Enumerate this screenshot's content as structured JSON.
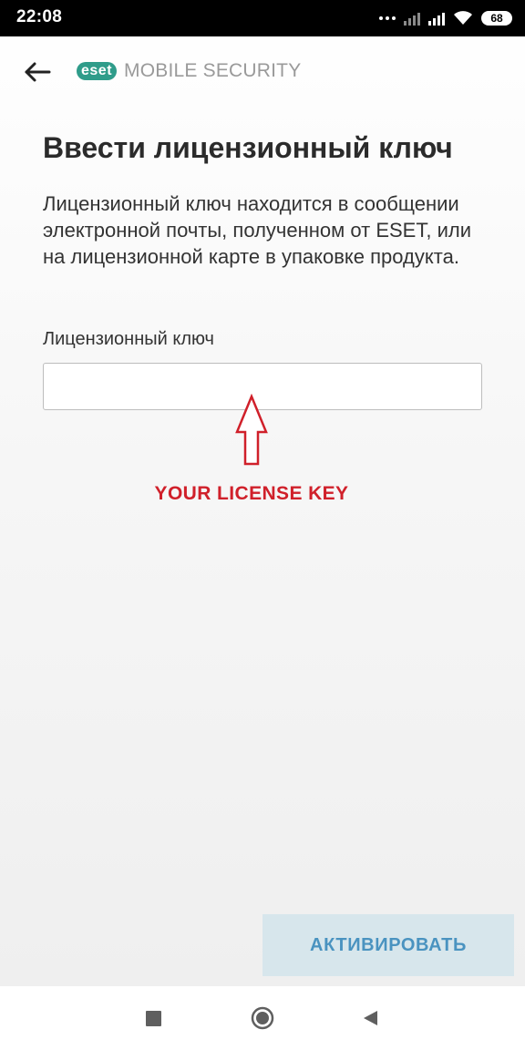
{
  "status_bar": {
    "time": "22:08",
    "battery": "68",
    "icons": [
      "more-dots-icon",
      "signal-icon",
      "signal-icon",
      "wifi-icon",
      "battery-icon"
    ]
  },
  "header": {
    "back_icon": "arrow-left-icon",
    "logo_text": "eset",
    "brand_text": "MOBILE SECURITY"
  },
  "main": {
    "title": "Ввести лицензионный ключ",
    "description": "Лицензионный ключ находится в сообщении электронной почты, полученном от ESET, или на лицензионной карте в упаковке продукта.",
    "field_label": "Лицензионный ключ",
    "license_input": {
      "value": "",
      "placeholder": ""
    },
    "annotation": "YOUR LICENSE KEY",
    "activate_label": "АКТИВИРОВАТЬ"
  },
  "nav_bar": {
    "icons": [
      "recents-square-icon",
      "home-circle-icon",
      "back-triangle-icon"
    ]
  },
  "colors": {
    "brand_teal": "#2f9c8a",
    "annotation_red": "#d0202a",
    "button_bg": "#d7e6ec",
    "button_text": "#4a93c0"
  }
}
